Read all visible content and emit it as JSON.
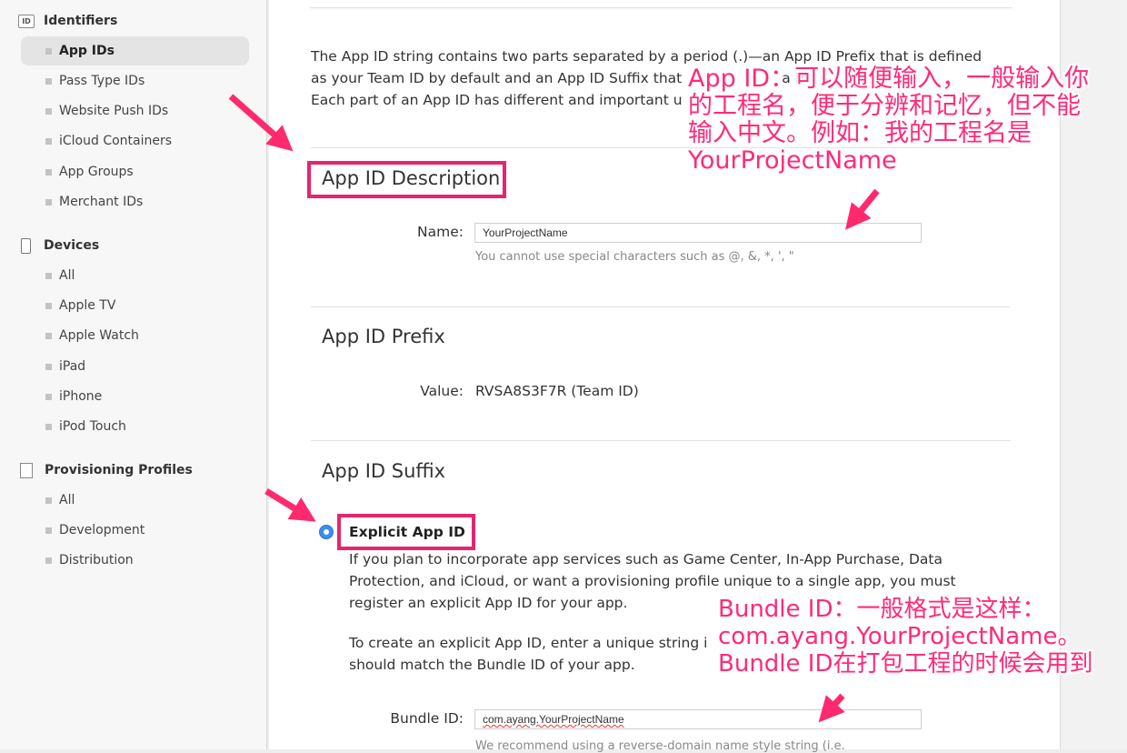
{
  "sidebar": {
    "identifiers": {
      "title": "Identifiers",
      "icon_text": "ID",
      "items": [
        "App IDs",
        "Pass Type IDs",
        "Website Push IDs",
        "iCloud Containers",
        "App Groups",
        "Merchant IDs"
      ]
    },
    "devices": {
      "title": "Devices",
      "items": [
        "All",
        "Apple TV",
        "Apple Watch",
        "iPad",
        "iPhone",
        "iPod Touch"
      ]
    },
    "profiles": {
      "title": "Provisioning Profiles",
      "items": [
        "All",
        "Development",
        "Distribution"
      ]
    }
  },
  "main": {
    "intro_line1": "The App ID string contains two parts separated by a period (.)—an App ID Prefix that is defined",
    "intro_line2": "as your Team ID by default and an App ID Suffix that",
    "intro_line2_tail": "a B",
    "intro_line3": "Each part of an App ID has different and important u",
    "intro_line3_tail": "p.",
    "description": {
      "heading": "App ID Description",
      "name_label": "Name:",
      "name_value": "YourProjectName",
      "name_hint": "You cannot use special characters such as @, &, *, ', \""
    },
    "prefix": {
      "heading": "App ID Prefix",
      "value_label": "Value:",
      "value": "RVSA8S3F7R (Team ID)"
    },
    "suffix": {
      "heading": "App ID Suffix",
      "explicit_label": "Explicit App ID",
      "explicit_text1": "If you plan to incorporate app services such as Game Center, In-App Purchase, Data",
      "explicit_text2": "Protection, and iCloud, or want a provisioning profile unique to a single app, you must",
      "explicit_text3": "register an explicit App ID for your app.",
      "create_text1": "To create an explicit App ID, enter a unique string i",
      "create_text2": "should match the Bundle ID of your app.",
      "bundle_label": "Bundle ID:",
      "bundle_value": "com.ayang.YourProjectName",
      "bundle_hint": "We recommend using a reverse-domain name style string (i.e."
    }
  },
  "annotations": {
    "app_id_note": [
      "App ID：可以随便输入，一般输入你",
      "的工程名，便于分辨和记忆，但不能",
      "输入中文。例如：我的工程名是",
      "YourProjectName"
    ],
    "bundle_note": [
      "Bundle ID：一般格式是这样：",
      "com.ayang.YourProjectName。",
      "Bundle ID在打包工程的时候会用到"
    ]
  },
  "colors": {
    "accent_pink": "#e6246f",
    "radio_blue": "#3b8ef0",
    "annotation_pink": "#ff2a7a"
  }
}
